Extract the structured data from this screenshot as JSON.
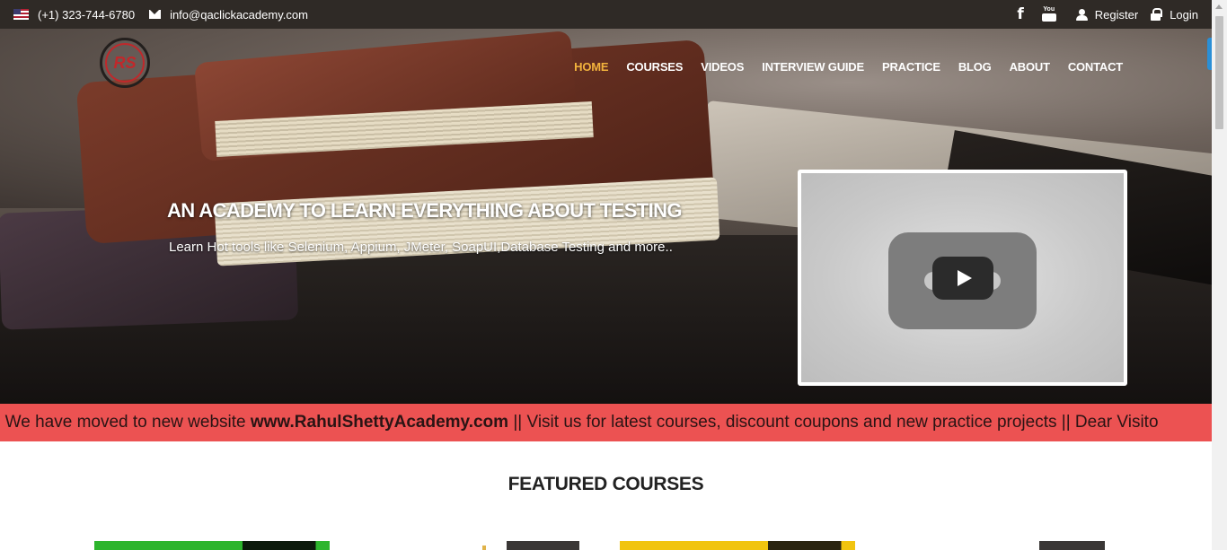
{
  "topbar": {
    "phone": "(+1) 323-744-6780",
    "email": "info@qaclickacademy.com",
    "register": "Register",
    "login": "Login"
  },
  "logo": {
    "text": "RS"
  },
  "nav": [
    {
      "label": "HOME",
      "active": true
    },
    {
      "label": "COURSES"
    },
    {
      "label": "VIDEOS"
    },
    {
      "label": "INTERVIEW GUIDE"
    },
    {
      "label": "PRACTICE"
    },
    {
      "label": "BLOG"
    },
    {
      "label": "ABOUT"
    },
    {
      "label": "CONTACT"
    }
  ],
  "hero": {
    "title": "AN ACADEMY TO LEARN EVERYTHING ABOUT TESTING",
    "subtitle": "Learn Hot tools like Selenium, Appium, JMeter, SoapUI,Database Testing and more.."
  },
  "marquee": {
    "prefix": "tor, We have moved to new website ",
    "link": "www.RahulShettyAcademy.com",
    "suffix": " || Visit us for latest courses, discount coupons and new practice projects || Dear Visito"
  },
  "featured": {
    "title": "FEATURED COURSES"
  },
  "colors": {
    "topbar_bg": "#2f2a26",
    "nav_active": "#f2b33d",
    "marquee_bg": "#ec5252",
    "logo_red": "#c0282b"
  },
  "icons": [
    "us-flag-icon",
    "envelope-icon",
    "facebook-icon",
    "youtube-icon",
    "user-icon",
    "lock-icon",
    "play-icon"
  ]
}
